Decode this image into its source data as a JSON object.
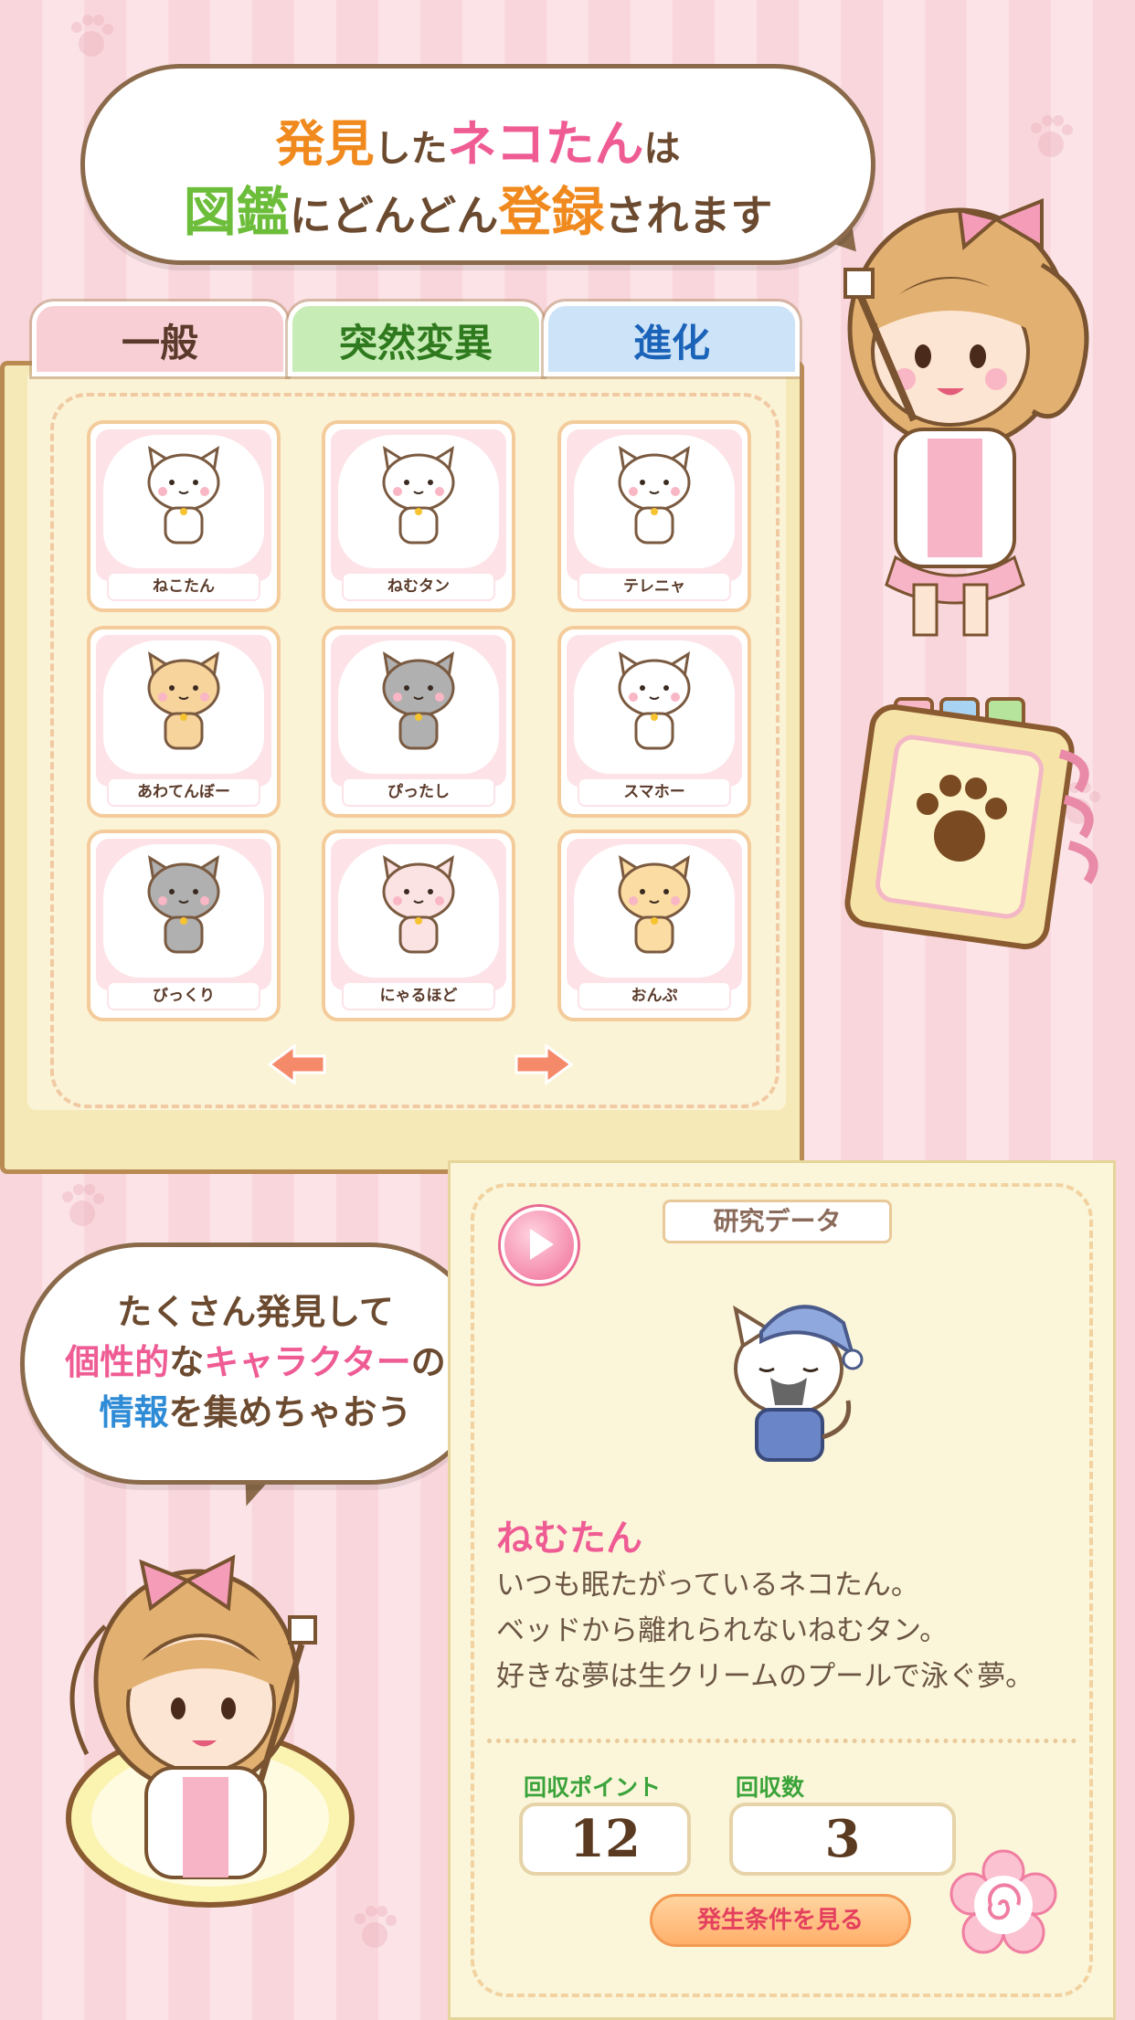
{
  "header_bubble": {
    "line1": [
      {
        "text": "発見",
        "color": "orange"
      },
      {
        "text": "した",
        "color": "brown"
      },
      {
        "text": "ネコたん",
        "color": "pink"
      },
      {
        "text": "は",
        "color": "brown"
      }
    ],
    "line2": [
      {
        "text": "図鑑",
        "color": "green"
      },
      {
        "text": "にどんどん",
        "color": "brown"
      },
      {
        "text": "登録",
        "color": "orange"
      },
      {
        "text": "されます",
        "color": "brown"
      }
    ]
  },
  "tabs": [
    {
      "label": "一般"
    },
    {
      "label": "突然変異"
    },
    {
      "label": "進化"
    }
  ],
  "catalog": [
    {
      "name": "ねこたん",
      "icon": "white-cat-icon"
    },
    {
      "name": "ねむタン",
      "icon": "sleepy-cat-icon"
    },
    {
      "name": "テレニャ",
      "icon": "bouquet-cat-icon"
    },
    {
      "name": "あわてんぼー",
      "icon": "panic-cat-icon"
    },
    {
      "name": "ぴったし",
      "icon": "clock-cat-icon"
    },
    {
      "name": "スマホー",
      "icon": "phone-cat-icon"
    },
    {
      "name": "びっくり",
      "icon": "surprised-cat-icon"
    },
    {
      "name": "にゃるほど",
      "icon": "nodding-cat-icon"
    },
    {
      "name": "おんぷ",
      "icon": "music-note-cat-icon"
    }
  ],
  "bubble2": {
    "line1": [
      {
        "text": "たくさん発見して",
        "color": "brown"
      }
    ],
    "line2": [
      {
        "text": "個性的",
        "color": "pink"
      },
      {
        "text": "な",
        "color": "brown"
      },
      {
        "text": "キャラクター",
        "color": "pink"
      },
      {
        "text": "の",
        "color": "brown"
      }
    ],
    "line3": [
      {
        "text": "情報",
        "color": "blue"
      },
      {
        "text": "を集めちゃおう",
        "color": "brown"
      }
    ]
  },
  "detail": {
    "section_label": "研究データ",
    "name": "ねむたん",
    "description": [
      "いつも眠たがっているネコたん。",
      "ベッドから離れられないねむタン。",
      "好きな夢は生クリームのプールで泳ぐ夢。"
    ],
    "points_label": "回収ポイント",
    "points_value": "12",
    "count_label": "回収数",
    "count_value": "3",
    "condition_button": "発生条件を見る"
  },
  "colors": {
    "orange": "#f08a1e",
    "pink": "#ef5c94",
    "green": "#6cbd3a",
    "brown": "#6b4a2f",
    "blue": "#2e8bd6"
  }
}
